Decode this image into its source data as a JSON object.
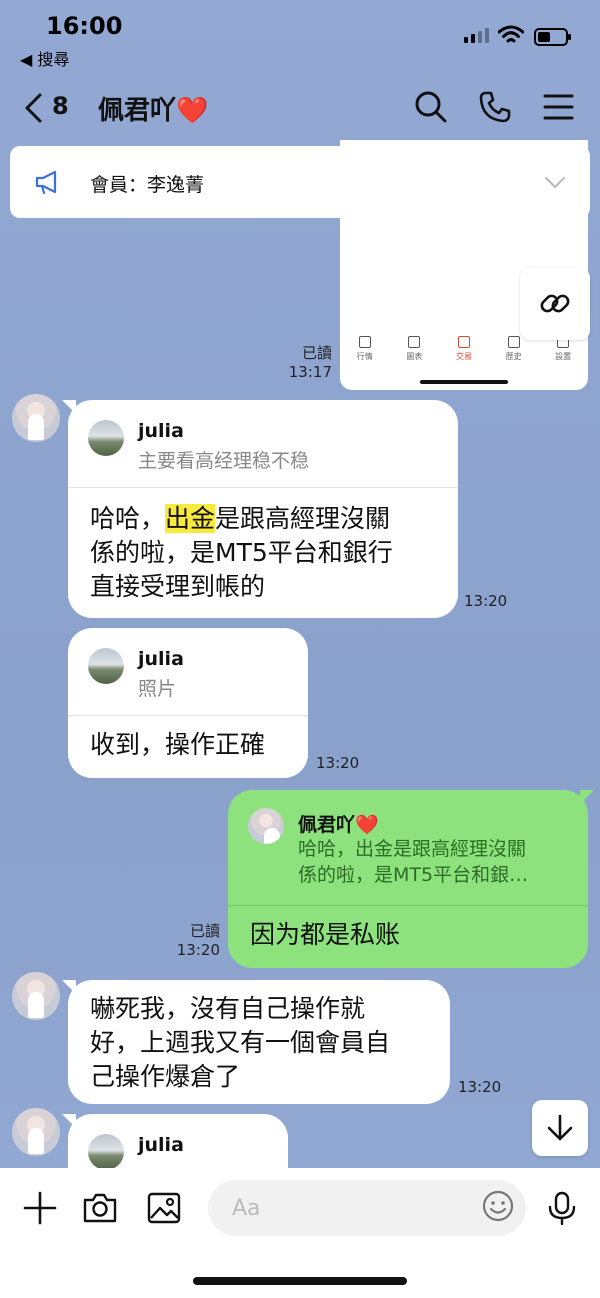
{
  "status": {
    "time": "16:00",
    "back_app": "◀ 搜尋"
  },
  "header": {
    "back_count": "8",
    "title": "佩君吖❤️"
  },
  "notice": {
    "text": "會員：李逸菁"
  },
  "screenshot_tabs": [
    "行情",
    "圖表",
    "交易",
    "歷史",
    "設置"
  ],
  "messages": {
    "m1": {
      "read": "已讀",
      "time": "13:17"
    },
    "m2": {
      "quote_name": "julia",
      "quote_text": "主要看高经理稳不稳",
      "line1_pre": "哈哈，",
      "line1_hl": "出金",
      "line1_post": "是跟高經理沒關",
      "line2": "係的啦，是MT5平台和銀行",
      "line3": "直接受理到帳的",
      "time": "13:20"
    },
    "m3": {
      "quote_name": "julia",
      "quote_text": "照片",
      "text": "收到，操作正確",
      "time": "13:20"
    },
    "m4": {
      "quote_name": "佩君吖❤️",
      "quote_line1": "哈哈，出金是跟高經理沒關",
      "quote_line2": "係的啦，是MT5平台和銀…",
      "text": "因为都是私账",
      "read": "已讀",
      "time": "13:20"
    },
    "m5": {
      "line1": "嚇死我，沒有自己操作就",
      "line2": "好，上週我又有一個會員自",
      "line3": "己操作爆倉了",
      "time": "13:20"
    },
    "m6": {
      "quote_name": "julia"
    }
  },
  "input": {
    "placeholder": "Aa"
  },
  "colors": {
    "background": "#8ea5d0",
    "outgoing_bubble": "#8de27e",
    "incoming_bubble": "#ffffff",
    "highlight": "#f8ea3c"
  }
}
